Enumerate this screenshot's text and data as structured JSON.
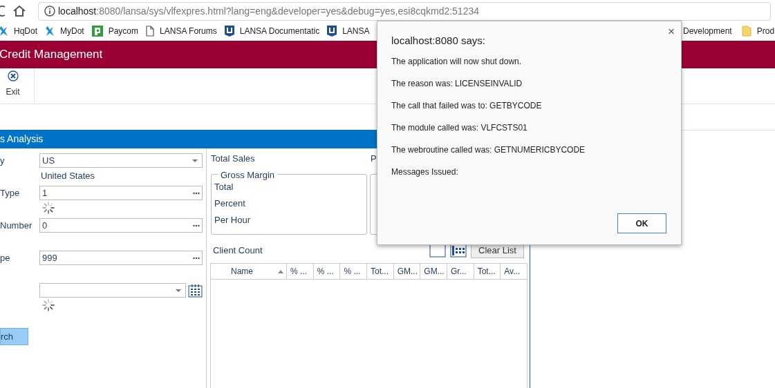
{
  "browser": {
    "url_host": "localhost",
    "url_rest": ":8080/lansa/sys/vlfexpres.html?lang=eng&developer=yes&debug=yes,esi8cqkmd2:51234",
    "bookmarks": [
      {
        "label": "HqDot",
        "kind": "figure"
      },
      {
        "label": "MyDot",
        "kind": "figure"
      },
      {
        "label": "Paycom",
        "kind": "square"
      },
      {
        "label": "LANSA Forums",
        "kind": "page"
      },
      {
        "label": "LANSA Documentatic",
        "kind": "badge"
      },
      {
        "label": "LANSA",
        "kind": "badge"
      }
    ],
    "bookmarks_right": [
      {
        "label": "Development",
        "kind": "none"
      },
      {
        "label": "Prod",
        "kind": "folder"
      }
    ]
  },
  "app": {
    "title": "Credit Management",
    "toolbar": [
      {
        "label": "Exit"
      }
    ],
    "panel_title": "s Analysis"
  },
  "form": [
    {
      "label": "y",
      "kind": "dropdown",
      "value": "US",
      "note": "United States",
      "loading": false
    },
    {
      "label": "Type",
      "kind": "lookup",
      "value": "1",
      "loading": true
    },
    {
      "label": "Number",
      "kind": "lookup",
      "value": "0",
      "loading": false
    },
    {
      "label": "pe",
      "kind": "lookup",
      "value": "999",
      "loading": false
    },
    {
      "kind": "date",
      "loading": true
    }
  ],
  "search_button": "rch",
  "summary": {
    "total_sales": "Total Sales",
    "second_heading": "P",
    "groups": [
      {
        "kind": "fieldset",
        "legend": "Gross Margin",
        "rows": [
          "Total",
          "Percent",
          "Per Hour"
        ]
      },
      {
        "kind": "box"
      }
    ]
  },
  "client_count": "Client Count",
  "clear_button": "Clear List",
  "table": {
    "columns": [
      {
        "label": "Name",
        "sorted": true
      },
      {
        "label": "% ...",
        "sorted": false
      },
      {
        "label": "% ...",
        "sorted": false
      },
      {
        "label": "% ...",
        "sorted": false
      },
      {
        "label": "Tot...",
        "sorted": false
      },
      {
        "label": "GM...",
        "sorted": false
      },
      {
        "label": "GM...",
        "sorted": false
      },
      {
        "label": "Gr...",
        "sorted": false
      },
      {
        "label": "Tot...",
        "sorted": false
      },
      {
        "label": "Av...",
        "sorted": false
      }
    ]
  },
  "dialog": {
    "title": "localhost:8080 says:",
    "lines": [
      "The application will now shut down.",
      "The reason was: LICENSEINVALID",
      "The call that failed was to: GETBYCODE",
      "The module called was: VLFCSTS01",
      "The webroutine called was: GETNUMERICBYCODE",
      "Messages Issued:"
    ],
    "close": "×",
    "button": "OK"
  }
}
